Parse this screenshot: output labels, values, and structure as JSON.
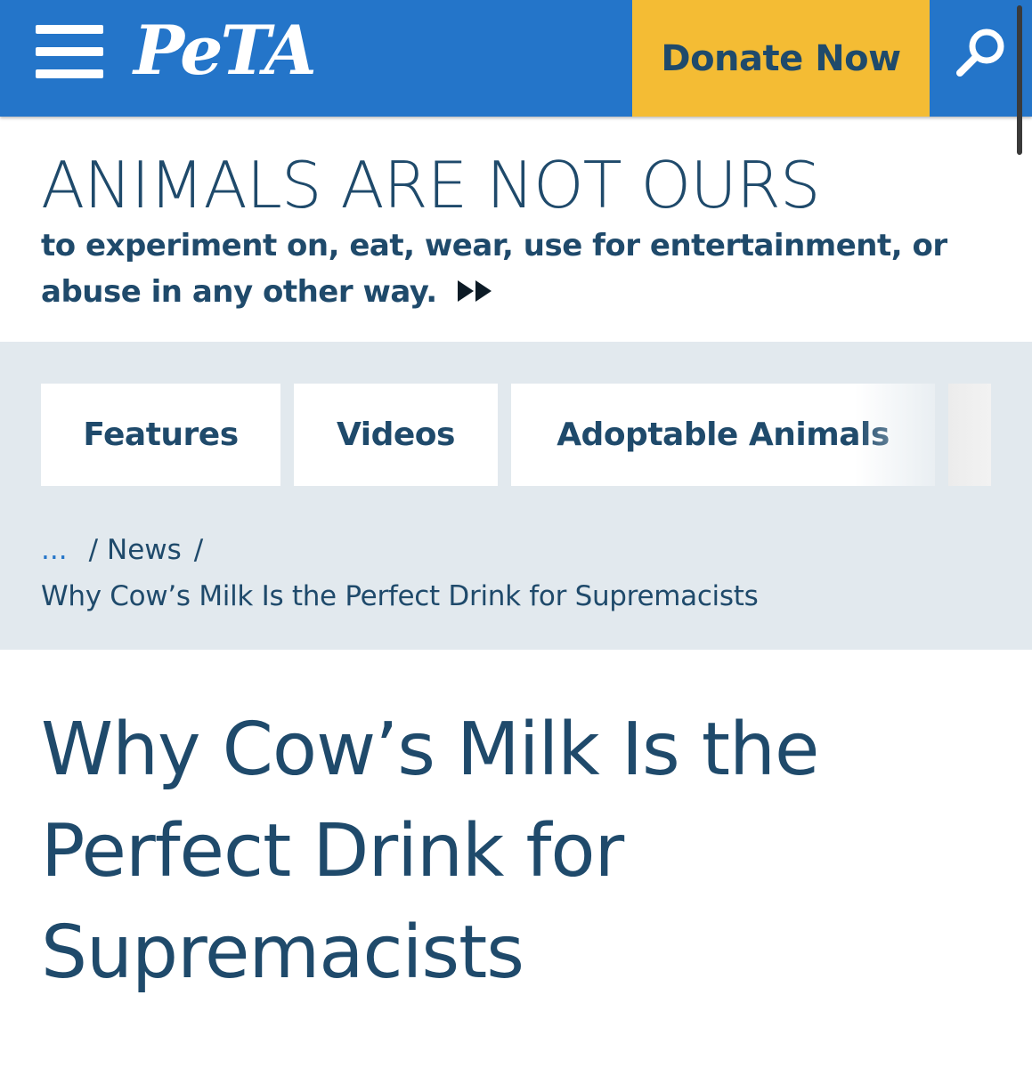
{
  "header": {
    "logo_text": "PeTA",
    "donate_label": "Donate Now",
    "menu_icon": "hamburger-menu-icon",
    "search_icon": "search-icon",
    "colors": {
      "header_bg": "#2475c9",
      "donate_bg": "#f4bc34",
      "text_dark": "#1f4a6b"
    }
  },
  "tagline": {
    "headline": "ANIMALS ARE NOT OURS",
    "subline": "to experiment on, eat, wear, use for entertainment, or abuse in any other way.",
    "more_icon": "fast-forward-icon"
  },
  "nav": {
    "tabs": [
      {
        "label": "Features"
      },
      {
        "label": "Videos"
      },
      {
        "label": "Adoptable Animals"
      }
    ]
  },
  "breadcrumb": {
    "ellipsis": "...",
    "separator": "/",
    "section": "News",
    "current": "Why Cow’s Milk Is the Perfect Drink for Supremacists"
  },
  "article": {
    "title": "Why Cow’s Milk Is the Perfect Drink for Supremacists"
  }
}
